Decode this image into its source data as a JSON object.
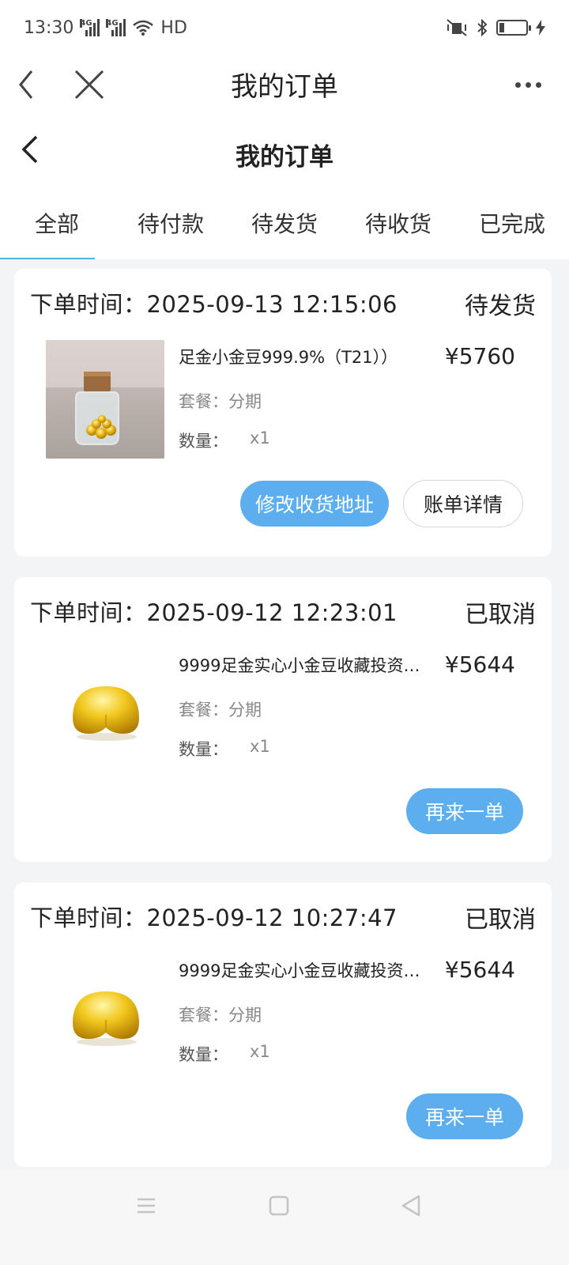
{
  "status_bar": {
    "time": "13:30",
    "net1": "4G",
    "net2": "4G",
    "hd": "HD"
  },
  "nav": {
    "title": "我的订单"
  },
  "page": {
    "title": "我的订单"
  },
  "tabs": [
    {
      "label": "全部",
      "active": true
    },
    {
      "label": "待付款",
      "active": false
    },
    {
      "label": "待发货",
      "active": false
    },
    {
      "label": "待收货",
      "active": false
    },
    {
      "label": "已完成",
      "active": false
    }
  ],
  "orders": [
    {
      "time": "下单时间：2025-09-13 12:15:06",
      "status": "待发货",
      "product_name": "足金小金豆999.9%（T21））",
      "price": "¥5760",
      "plan": "套餐：分期",
      "qty_label": "数量：",
      "qty": "x1",
      "buttons": [
        "修改收货地址",
        "账单详情"
      ]
    },
    {
      "time": "下单时间：2025-09-12 12:23:01",
      "status": "已取消",
      "product_name": "9999足金实心小金豆收藏投资…",
      "price": "¥5644",
      "plan": "套餐：分期",
      "qty_label": "数量：",
      "qty": "x1",
      "buttons": [
        "再来一单"
      ]
    },
    {
      "time": "下单时间：2025-09-12 10:27:47",
      "status": "已取消",
      "product_name": "9999足金实心小金豆收藏投资…",
      "price": "¥5644",
      "plan": "套餐：分期",
      "qty_label": "数量：",
      "qty": "x1",
      "buttons": [
        "再来一单"
      ]
    }
  ],
  "colors": {
    "accent": "#5daeee",
    "tab_underline": "#4fb3e8",
    "background": "#f3f4f6"
  },
  "icons": {
    "nav_back": "chevron-left-icon",
    "nav_close": "close-icon",
    "nav_more": "more-dots-icon",
    "page_back": "chevron-left-icon",
    "sys_menu": "menu-icon",
    "sys_home": "home-square-icon",
    "sys_back": "triangle-back-icon"
  }
}
